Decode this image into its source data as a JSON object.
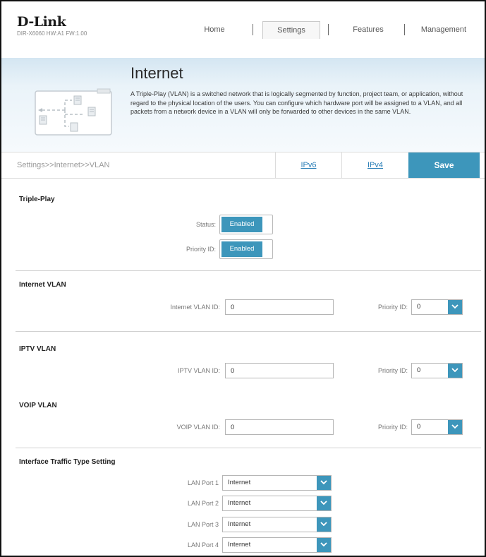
{
  "header": {
    "logo": "D-Link",
    "model": "DIR-X6060 HW:A1 FW:1.00",
    "nav": [
      {
        "label": "Home"
      },
      {
        "label": "Settings"
      },
      {
        "label": "Features"
      },
      {
        "label": "Management"
      }
    ],
    "active_nav": "Settings"
  },
  "banner": {
    "title": "Internet",
    "description": "A Triple-Play (VLAN) is a switched network that is logically segmented by function, project team, or application, without regard to the physical location of the users. You can configure which hardware port will be assigned to a VLAN, and all packets from a network device in a VLAN will only be forwarded to other devices in the same VLAN."
  },
  "breadcrumb": "Settings>>Internet>>VLAN",
  "tabs": {
    "ipv6": "IPv6",
    "ipv4": "IPv4",
    "save": "Save"
  },
  "triple_play": {
    "title": "Triple-Play",
    "status_label": "Status:",
    "status_value": "Enabled",
    "priority_label": "Priority ID:",
    "priority_value": "Enabled"
  },
  "internet_vlan": {
    "title": "Internet VLAN",
    "id_label": "Internet VLAN ID:",
    "id_value": "0",
    "priority_label": "Priority ID:",
    "priority_value": "0"
  },
  "iptv_vlan": {
    "title": "IPTV VLAN",
    "id_label": "IPTV VLAN ID:",
    "id_value": "0",
    "priority_label": "Priority ID:",
    "priority_value": "0"
  },
  "voip_vlan": {
    "title": "VOIP VLAN",
    "id_label": "VOIP VLAN ID:",
    "id_value": "0",
    "priority_label": "Priority ID:",
    "priority_value": "0"
  },
  "interface_traffic": {
    "title": "Interface Traffic Type Setting",
    "ports": [
      {
        "label": "LAN Port 1",
        "value": "Internet"
      },
      {
        "label": "LAN Port 2",
        "value": "Internet"
      },
      {
        "label": "LAN Port 3",
        "value": "Internet"
      },
      {
        "label": "LAN Port 4",
        "value": "Internet"
      }
    ]
  },
  "colors": {
    "accent": "#3d96bb",
    "link": "#2b7fb8"
  }
}
